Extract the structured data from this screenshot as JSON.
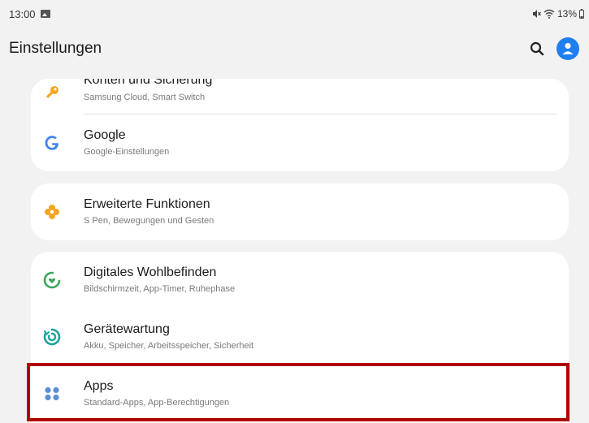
{
  "status_bar": {
    "time": "13:00",
    "battery": "13%",
    "icons": [
      "gallery-icon",
      "mute-icon",
      "wifi-icon",
      "battery-icon"
    ]
  },
  "header": {
    "title": "Einstellungen",
    "icons": [
      "search-icon",
      "profile-icon"
    ],
    "accent_color": "#1f7ef0"
  },
  "settings": {
    "group1": [
      {
        "title": "Konten und Sicherung",
        "subtitle": "Samsung Cloud, Smart Switch",
        "icon": "key-icon",
        "color": "#f5a623"
      },
      {
        "title": "Google",
        "subtitle": "Google-Einstellungen",
        "icon": "google-icon",
        "color": "#4285f4"
      }
    ],
    "group2": [
      {
        "title": "Erweiterte Funktionen",
        "subtitle": "S Pen, Bewegungen und Gesten",
        "icon": "advanced-features-icon",
        "color": "#f5a623"
      }
    ],
    "group3": [
      {
        "title": "Digitales Wohlbefinden",
        "subtitle": "Bildschirmzeit, App-Timer, Ruhephase",
        "icon": "digital-wellbeing-icon",
        "color": "#3aa55b"
      },
      {
        "title": "Gerätewartung",
        "subtitle": "Akku, Speicher, Arbeitsspeicher, Sicherheit",
        "icon": "device-care-icon",
        "color": "#1aa39a"
      },
      {
        "title": "Apps",
        "subtitle": "Standard-Apps, App-Berechtigungen",
        "icon": "apps-icon",
        "color": "#5b8fd6"
      }
    ]
  },
  "highlight_color": "#b00000"
}
